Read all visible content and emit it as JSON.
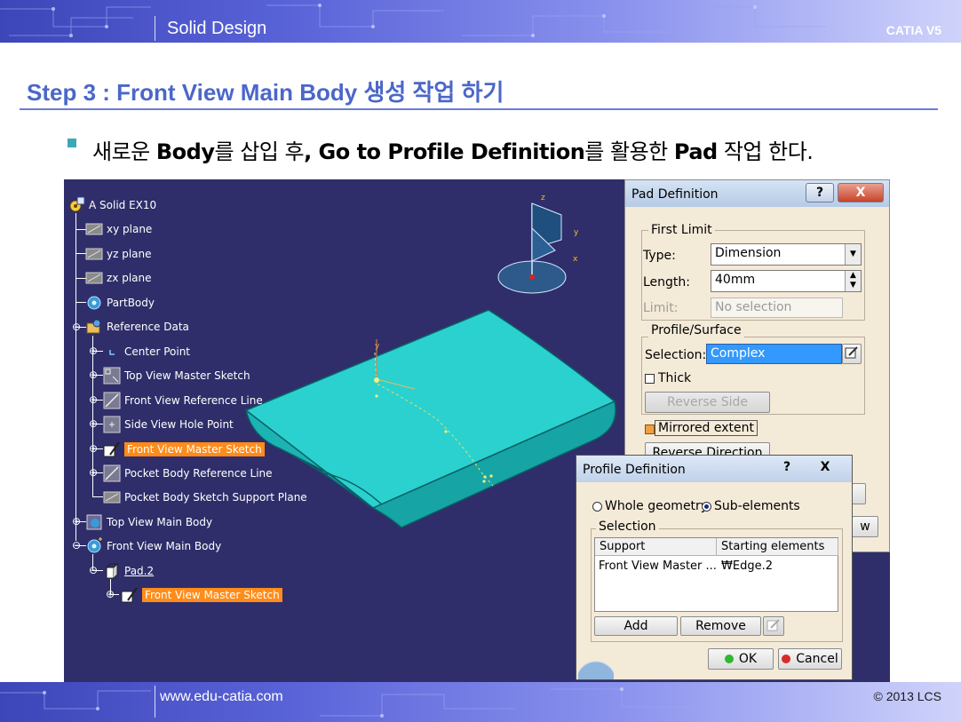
{
  "slide": {
    "header_title": "Solid Design",
    "brand": "CATIA V5",
    "step_title": "Step 3 : Front View Main Body 생성 작업 하기",
    "bullet": {
      "p1": "새로운 ",
      "b1": "Body",
      "p2": "를 삽입 후",
      "b2": ", Go to Profile Definition",
      "p3": "를 활용한 ",
      "b3": "Pad",
      "p4": " 작업 한다."
    },
    "footer_url": "www.edu-catia.com",
    "footer_copy": "© 2013 LCS"
  },
  "tree": {
    "root": "A Solid EX10",
    "xy": "xy plane",
    "yz": "yz plane",
    "zx": "zx plane",
    "partbody": "PartBody",
    "refdata": "Reference Data",
    "center": "Center Point",
    "topsketch": "Top View Master Sketch",
    "frontref": "Front View Reference Line",
    "sidehole": "Side View Hole Point",
    "frontsketch": "Front View Master Sketch",
    "pocketref": "Pocket Body Reference Line",
    "pocketplane": "Pocket Body Sketch Support Plane",
    "topbody": "Top View Main Body",
    "frontbody": "Front View Main Body",
    "pad": "Pad.2",
    "padsketch": "Front View Master Sketch"
  },
  "axes": {
    "x": "x",
    "y": "y",
    "z": "z"
  },
  "pad_dialog": {
    "title": "Pad Definition",
    "help": "?",
    "close": "X",
    "first_limit": "First Limit",
    "type_label": "Type:",
    "type_value": "Dimension",
    "length_label": "Length:",
    "length_value": "40mm",
    "limit_label": "Limit:",
    "limit_value": "No selection",
    "profile_group": "Profile/Surface",
    "selection_label": "Selection:",
    "selection_value": "Complex",
    "thick": "Thick",
    "reverse_side": "Reverse Side",
    "mirrored": "Mirrored extent",
    "reverse_direction": "Reverse Direction",
    "hidden_button_tail": "w"
  },
  "profile_dialog": {
    "title": "Profile Definition",
    "help": "?",
    "close": "X",
    "whole": "Whole geometry",
    "sub": "Sub-elements",
    "selection_group": "Selection",
    "col_support": "Support",
    "col_start": "Starting elements",
    "row_support": "Front View Master ...",
    "row_start": "₩Edge.2",
    "add": "Add",
    "remove": "Remove",
    "ok": "OK",
    "cancel": "Cancel"
  },
  "colors": {
    "viewport_bg": "#2f2e6a",
    "highlight": "#ff8c1a",
    "surface": "#1fbfbf",
    "title_blue": "#4b67c9"
  }
}
